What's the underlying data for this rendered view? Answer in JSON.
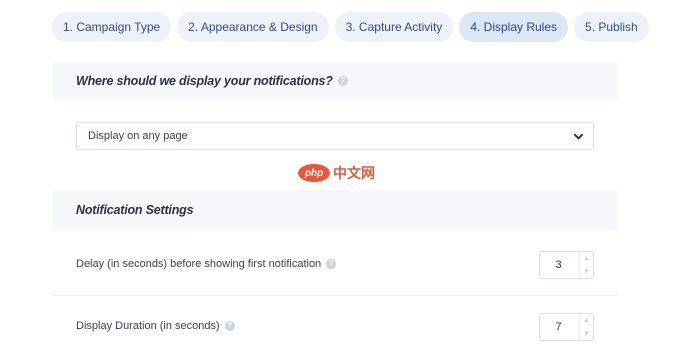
{
  "tabs": [
    {
      "label": "1. Campaign Type"
    },
    {
      "label": "2. Appearance & Design"
    },
    {
      "label": "3. Capture Activity"
    },
    {
      "label": "4. Display Rules"
    },
    {
      "label": "5. Publish"
    }
  ],
  "display_section": {
    "title": "Where should we display your notifications?",
    "help_icon": "question-icon",
    "select_value": "Display on any page"
  },
  "watermark": {
    "badge": "php",
    "text": "中文网"
  },
  "settings_section": {
    "title": "Notification Settings",
    "rows": [
      {
        "label": "Delay (in seconds) before showing first notification",
        "value": "3"
      },
      {
        "label": "Display Duration (in seconds)",
        "value": "7"
      }
    ]
  },
  "colors": {
    "tab_bg": "#edf2f9",
    "tab_active_bg": "#dde6f3",
    "tab_text": "#2f4e7d",
    "section_bg": "#f5f7fa",
    "watermark": "#e8573c"
  }
}
